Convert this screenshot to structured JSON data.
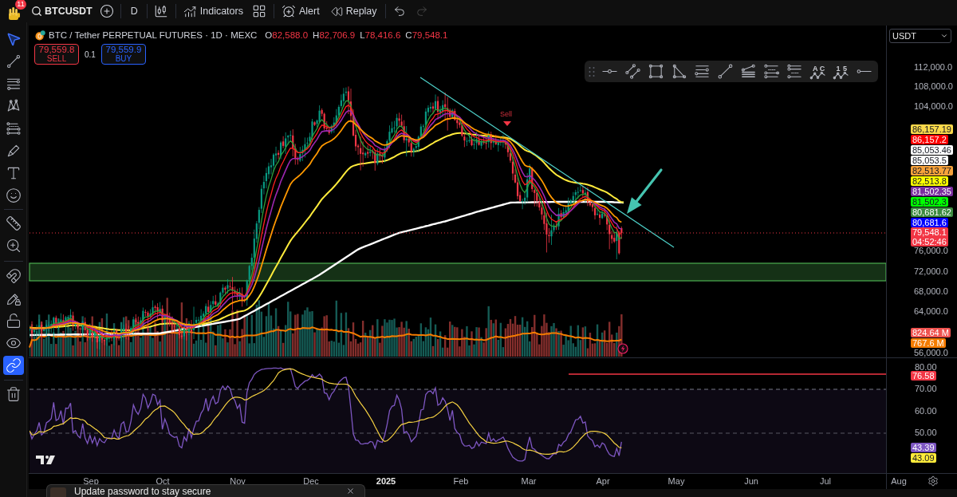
{
  "top_toolbar": {
    "notifications": "11",
    "symbol": "BTCUSDT",
    "interval": "D",
    "indicators": "Indicators",
    "alert": "Alert",
    "replay": "Replay",
    "undo": {
      "disabled": false
    },
    "redo": {
      "disabled": true
    }
  },
  "left_toolbar": {
    "drawing_tools": [
      {
        "selected": true
      },
      {
        "selected": false
      },
      {
        "selected": false
      },
      {
        "selected": false
      },
      {
        "selected": false
      },
      {
        "selected": false
      },
      {
        "selected": false
      },
      {
        "selected": false
      }
    ],
    "toggles": [
      {
        "on": false
      },
      {
        "on": false
      },
      {
        "on": false
      },
      {
        "on": false
      },
      {
        "on": true
      }
    ]
  },
  "legend": {
    "title": "BTC / Tether PERPETUAL FUTURES · 1D · MEXC",
    "ohlc": [
      {
        "key": "O",
        "value": "82,588.0"
      },
      {
        "key": "H",
        "value": "82,706.9"
      },
      {
        "key": "L",
        "value": "78,416.6"
      },
      {
        "key": "C",
        "value": "79,548.1"
      }
    ]
  },
  "order_panel": {
    "sell": {
      "price": "79,559.8",
      "label": "SELL"
    },
    "quantity": "0.1",
    "buy": {
      "price": "79,559.9",
      "label": "BUY"
    }
  },
  "signals": [
    {
      "label": "Sell"
    }
  ],
  "drawing_toolbar": {
    "pattern_letters": [
      "A",
      "C"
    ],
    "wave_numbers": [
      "1",
      "5"
    ]
  },
  "price_axis": {
    "currency": "USDT",
    "ticks": [
      "112,000.0",
      "108,000.0",
      "104,000.0",
      "76,000.0",
      "72,000.0",
      "68,000.0",
      "64,000.0",
      "56,000.0"
    ],
    "labels": [
      {
        "text": "86,157.19",
        "color": "#f9d84a"
      },
      {
        "text": "86,157.2",
        "color": "#ff0000"
      },
      {
        "text": "85,053.46",
        "color": "#ffffff"
      },
      {
        "text": "85,053.5",
        "color": "#ffffff"
      },
      {
        "text": "82,513.77",
        "color": "#f7a23b"
      },
      {
        "text": "82,513.8",
        "color": "#ffff00"
      },
      {
        "text": "81,502.35",
        "color": "#7b2fa0"
      },
      {
        "text": "81,502.3",
        "color": "#00ff00"
      },
      {
        "text": "80,681.62",
        "color": "#3d8b40"
      },
      {
        "text": "80,681.6",
        "color": "#0000ff"
      }
    ],
    "current_price": {
      "price": "79,548.1",
      "countdown": "04:52:46",
      "color": "#f23645"
    },
    "volume_labels": [
      {
        "text": "824.64 M",
        "color": "#ef5350"
      },
      {
        "text": "767.6 M",
        "color": "#f57c00"
      }
    ]
  },
  "rsi_axis": {
    "ticks": [
      "80.00",
      "70.00",
      "60.00",
      "50.00"
    ],
    "labels": [
      {
        "text": "76.58",
        "color": "#f23645"
      },
      {
        "text": "43.39",
        "color": "#7e57c2"
      },
      {
        "text": "43.09",
        "color": "#ffeb3b"
      }
    ]
  },
  "time_axis": {
    "labels": [
      {
        "text": "Sep",
        "kind": "month"
      },
      {
        "text": "Oct",
        "kind": "month"
      },
      {
        "text": "Nov",
        "kind": "month"
      },
      {
        "text": "Dec",
        "kind": "month"
      },
      {
        "text": "2025",
        "kind": "year"
      },
      {
        "text": "Feb",
        "kind": "month"
      },
      {
        "text": "Mar",
        "kind": "month"
      },
      {
        "text": "Apr",
        "kind": "month"
      },
      {
        "text": "May",
        "kind": "month"
      },
      {
        "text": "Jun",
        "kind": "month"
      },
      {
        "text": "Jul",
        "kind": "month"
      },
      {
        "text": "Aug",
        "kind": "month"
      }
    ]
  },
  "toast": {
    "message": "Update password to stay secure"
  }
}
